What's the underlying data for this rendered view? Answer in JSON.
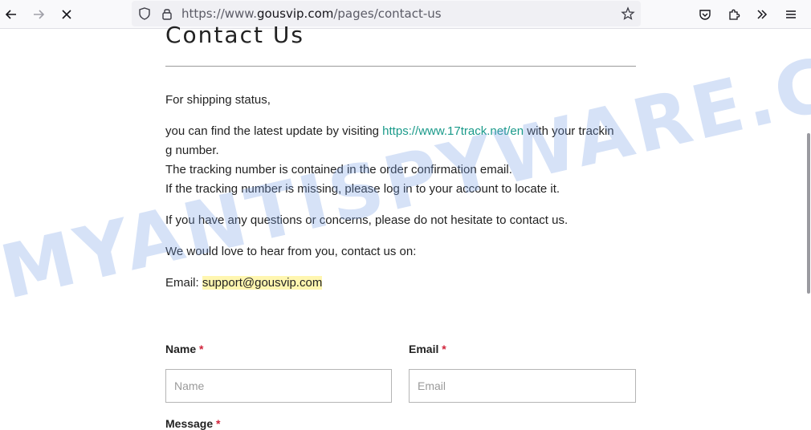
{
  "browser": {
    "url_prefix": "https://www.",
    "url_host": "gousvip.com",
    "url_path": "/pages/contact-us"
  },
  "page": {
    "title": "Contact Us",
    "p1": "For shipping status,",
    "p2_before": "you can find the latest update by visiting ",
    "p2_link": "https://www.17track.net/en",
    "p2_after_line1": " with your trackin",
    "p2_line2": "g number.",
    "p2_line3": "The tracking number is contained in the order confirmation email.",
    "p2_line4": "If the tracking number is missing, please log in to your account to locate it.",
    "p3": "If you have any questions or concerns, please do not hesitate to contact us.",
    "p4": "We would love to hear from you, contact us on:",
    "email_label": "Email: ",
    "email_value": "support@gousvip.com"
  },
  "form": {
    "name_label": "Name",
    "email_label": "Email",
    "required_mark": "*",
    "name_placeholder": "Name",
    "email_placeholder": "Email",
    "message_label": "Message"
  },
  "watermark": "MYANTISPYWARE.COM"
}
